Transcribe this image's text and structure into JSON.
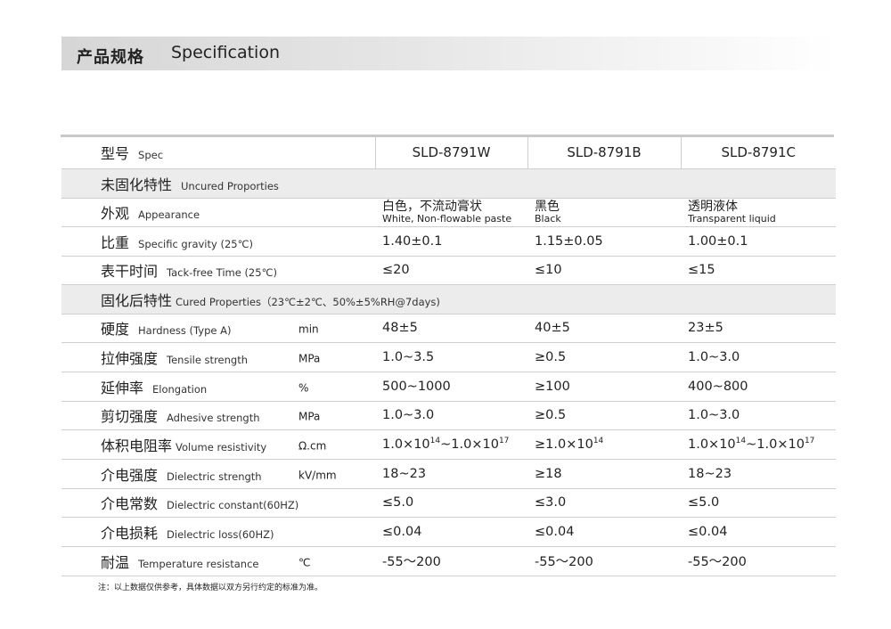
{
  "header": {
    "title_cn": "产品规格",
    "title_en": "Specification"
  },
  "spec_row": {
    "cn": "型号",
    "en": "Spec",
    "models": [
      "SLD-8791W",
      "SLD-8791B",
      "SLD-8791C"
    ]
  },
  "sections": {
    "uncured": {
      "cn": "未固化特性",
      "en": "Uncured Proporties"
    },
    "cured": {
      "cn": "固化后特性",
      "en": "Cured Properties（23℃±2℃、50%±5%RH@7days)"
    }
  },
  "uncured_rows": [
    {
      "cn": "外观",
      "en": "Appearance",
      "unit": "",
      "values": [
        {
          "cn": "白色，不流动膏状",
          "en": "White, Non-flowable paste"
        },
        {
          "cn": "黑色",
          "en": "Black"
        },
        {
          "cn": "透明液体",
          "en": "Transparent liquid"
        }
      ]
    },
    {
      "cn": "比重",
      "en": "Specific gravity (25℃)",
      "unit": "",
      "values": [
        "1.40±0.1",
        "1.15±0.05",
        "1.00±0.1"
      ]
    },
    {
      "cn": "表干时间",
      "en": "Tack-free Time (25℃)",
      "unit": "",
      "values": [
        "≤20",
        "≤10",
        "≤15"
      ]
    }
  ],
  "cured_rows": [
    {
      "cn": "硬度",
      "en": "Hardness (Type A)",
      "unit": "min",
      "values": [
        "48±5",
        "40±5",
        "23±5"
      ]
    },
    {
      "cn": "拉伸强度",
      "en": "Tensile strength",
      "unit": "MPa",
      "values": [
        "1.0~3.5",
        "≥0.5",
        "1.0~3.0"
      ]
    },
    {
      "cn": "延伸率",
      "en": "Elongation",
      "unit": "%",
      "values": [
        "500~1000",
        "≥100",
        "400~800"
      ]
    },
    {
      "cn": "剪切强度",
      "en": "Adhesive strength",
      "unit": "MPa",
      "values": [
        "1.0~3.0",
        "≥0.5",
        "1.0~3.0"
      ]
    },
    {
      "cn": "体积电阻率",
      "en": "Volume resistivity",
      "unit": "Ω.cm",
      "values_parts": [
        {
          "a": "1.0×10",
          "a_exp": "14",
          "b": "~1.0×10",
          "b_exp": "17"
        },
        {
          "a": "≥1.0×10",
          "a_exp": "14",
          "b": "",
          "b_exp": ""
        },
        {
          "a": "1.0×10",
          "a_exp": "14",
          "b": "~1.0×10",
          "b_exp": "17"
        }
      ]
    },
    {
      "cn": "介电强度",
      "en": "Dielectric strength",
      "unit": "kV/mm",
      "values": [
        "18~23",
        "≥18",
        "18~23"
      ]
    },
    {
      "cn": "介电常数",
      "en": "Dielectric constant(60HZ)",
      "unit": "",
      "values": [
        "≤5.0",
        "≤3.0",
        "≤5.0"
      ]
    },
    {
      "cn": "介电损耗",
      "en": "Dielectric loss(60HZ)",
      "unit": "",
      "values": [
        "≤0.04",
        "≤0.04",
        "≤0.04"
      ]
    },
    {
      "cn": "耐温",
      "en": "Temperature resistance",
      "unit": "℃",
      "values": [
        "-55～200",
        "-55～200",
        "-55～200"
      ]
    }
  ],
  "footnote": "注：以上数据仅供参考，具体数据以双方另行约定的标准为准。"
}
